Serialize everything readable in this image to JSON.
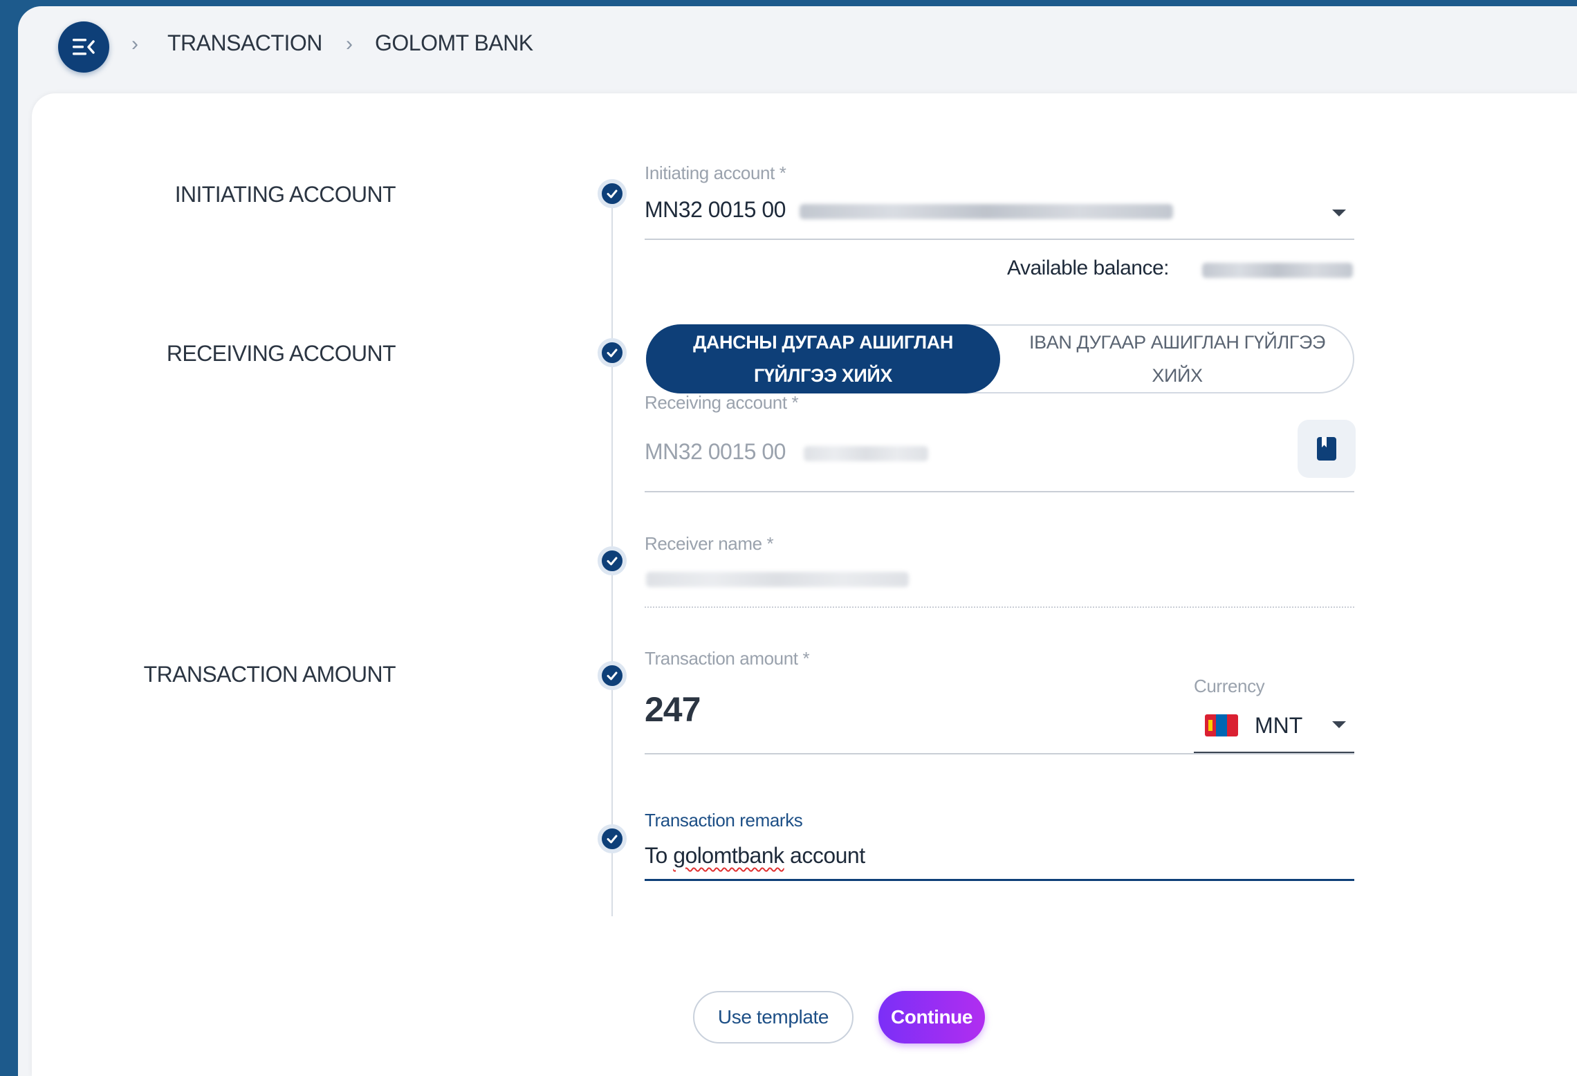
{
  "breadcrumb": {
    "items": [
      "TRANSACTION",
      "GOLOMT BANK"
    ]
  },
  "sections": {
    "initiating": "INITIATING ACCOUNT",
    "receiving": "RECEIVING ACCOUNT",
    "amount": "TRANSACTION AMOUNT"
  },
  "initiating_account": {
    "label": "Initiating account *",
    "value_prefix": "MN32 0015 00",
    "balance_label": "Available balance:"
  },
  "receive_mode": {
    "option_account": "ДАНСНЫ ДУГААР АШИГЛАН ГҮЙЛГЭЭ ХИЙХ",
    "option_iban": "IBAN ДУГААР АШИГЛАН ГҮЙЛГЭЭ ХИЙХ"
  },
  "receiving_account": {
    "label": "Receiving account *",
    "value_prefix": "MN32 0015 00"
  },
  "receiver_name": {
    "label": "Receiver name *"
  },
  "amount": {
    "label": "Transaction amount *",
    "value": "247",
    "currency_label": "Currency",
    "currency": "MNT"
  },
  "remarks": {
    "label": "Transaction remarks",
    "value_prefix": "To ",
    "value_misspelled": "golomtbank",
    "value_suffix": " account"
  },
  "actions": {
    "use_template": "Use template",
    "continue": "Continue"
  },
  "colors": {
    "primary": "#0e3f78",
    "accent_gradient_start": "#7b2ff7",
    "accent_gradient_end": "#b12ef0",
    "background": "#1d5a8c"
  },
  "icons": {
    "menu": "menu-collapse-icon",
    "breadcrumb_separator": "chevron-right-icon",
    "step": "check-circle-icon",
    "dropdown": "caret-down-icon",
    "address_book": "address-book-icon",
    "flag": "mongolia-flag-icon"
  }
}
